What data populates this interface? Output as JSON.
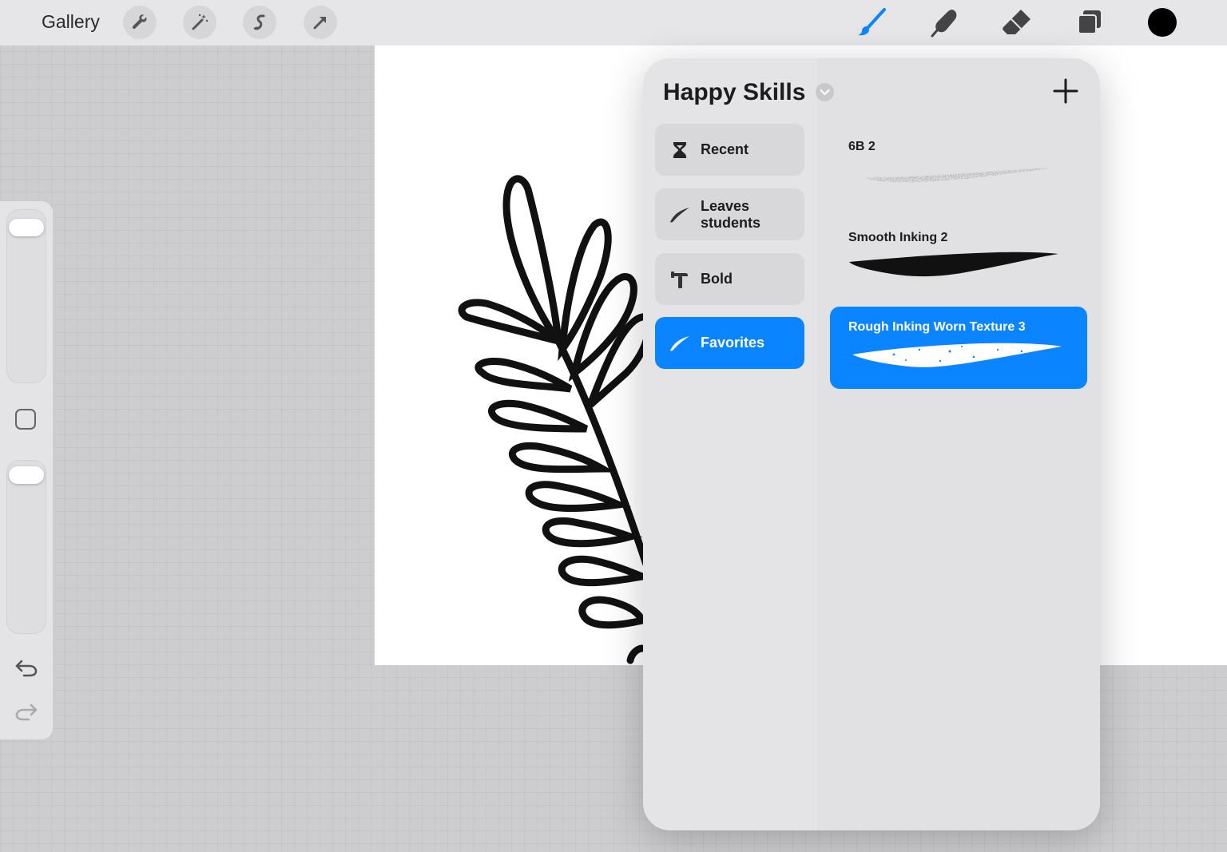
{
  "topbar": {
    "gallery_label": "Gallery",
    "left_tools": [
      "wrench-icon",
      "magic-wand-icon",
      "selection-icon",
      "transform-arrow-icon"
    ],
    "right_tools": [
      "brush-icon",
      "smudge-icon",
      "eraser-icon",
      "layers-icon"
    ],
    "current_color": "#000000",
    "accent_color": "#0a84ff"
  },
  "brush_library": {
    "title": "Happy Skills",
    "sets": [
      {
        "label": "Recent",
        "icon": "hourglass-icon",
        "active": false
      },
      {
        "label": "Leaves students",
        "icon": "brush-stroke-icon",
        "active": false
      },
      {
        "label": "Bold",
        "icon": "hammer-icon",
        "active": false
      },
      {
        "label": "Favorites",
        "icon": "brush-stroke-icon",
        "active": true
      }
    ],
    "brushes": [
      {
        "name": "6B 2",
        "active": false
      },
      {
        "name": "Smooth Inking 2",
        "active": false
      },
      {
        "name": "Rough Inking Worn Texture 3",
        "active": true
      }
    ]
  }
}
